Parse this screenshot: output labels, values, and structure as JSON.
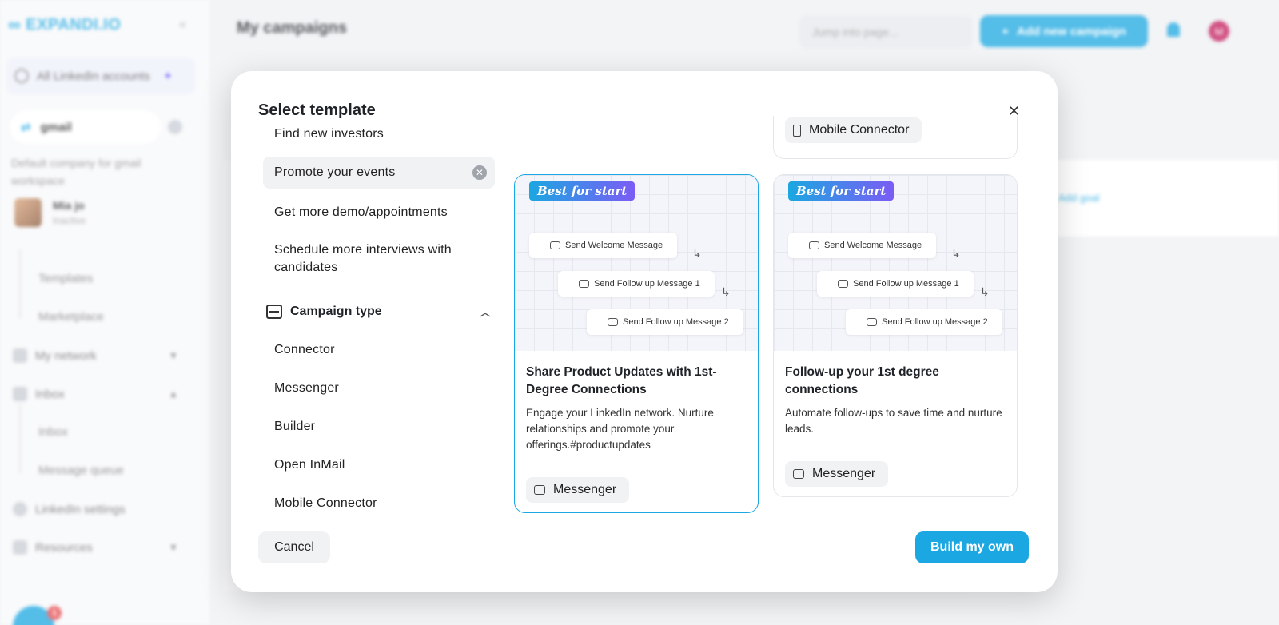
{
  "app": {
    "logo_text": "EXPANDI.IO",
    "collapse_icon": "chevrons-left-icon"
  },
  "sidebar": {
    "all_accounts": "All LinkedIn accounts",
    "workspace": "gmail",
    "workspace_desc": "Default company for gmail workspace",
    "user": {
      "name": "Mia jo",
      "status": "Inactive"
    },
    "items": [
      {
        "label": "Templates",
        "type": "sub"
      },
      {
        "label": "Marketplace",
        "type": "sub"
      },
      {
        "label": "My network",
        "type": "nav",
        "icon": "user-icon"
      },
      {
        "label": "Inbox",
        "type": "nav",
        "icon": "inbox-icon"
      },
      {
        "label": "Inbox",
        "type": "sub"
      },
      {
        "label": "Message queue",
        "type": "sub"
      },
      {
        "label": "LinkedIn settings",
        "type": "nav",
        "icon": "gear-icon"
      },
      {
        "label": "Resources",
        "type": "nav",
        "icon": "link-icon"
      }
    ],
    "chat_badge": "1"
  },
  "header": {
    "title": "My campaigns",
    "jump_placeholder": "Jump into page...",
    "add_button": "Add new campaign",
    "avatar_initial": "M"
  },
  "background": {
    "add_goal": "Add goal"
  },
  "modal": {
    "title": "Select template",
    "goals": [
      "Find new investors",
      "Promote your events",
      "Get more demo/appointments",
      "Schedule more interviews with candidates"
    ],
    "active_goal_index": 1,
    "campaign_type_heading": "Campaign type",
    "campaign_types": [
      "Connector",
      "Messenger",
      "Builder",
      "Open InMail",
      "Mobile Connector"
    ],
    "partial_card_chip": "Mobile Connector",
    "cards": [
      {
        "badge": "Best for start",
        "steps": [
          "Send Welcome Message",
          "Send Follow up Message 1",
          "Send Follow up Message 2"
        ],
        "title": "Share Product Updates with 1st-Degree Connections",
        "description": "Engage your LinkedIn network. Nurture relationships and promote your offerings.#productupdates",
        "chip": "Messenger",
        "selected": true
      },
      {
        "badge": "Best for start",
        "steps": [
          "Send Welcome Message",
          "Send Follow up Message 1",
          "Send Follow up Message 2"
        ],
        "title": "Follow-up your 1st degree connections",
        "description": "Automate follow-ups to save time and nurture leads.",
        "chip": "Messenger",
        "selected": false
      }
    ],
    "cancel": "Cancel",
    "build": "Build my own"
  },
  "colors": {
    "accent": "#1ba7e1",
    "badge_gradient_end": "#7b5cf5"
  }
}
